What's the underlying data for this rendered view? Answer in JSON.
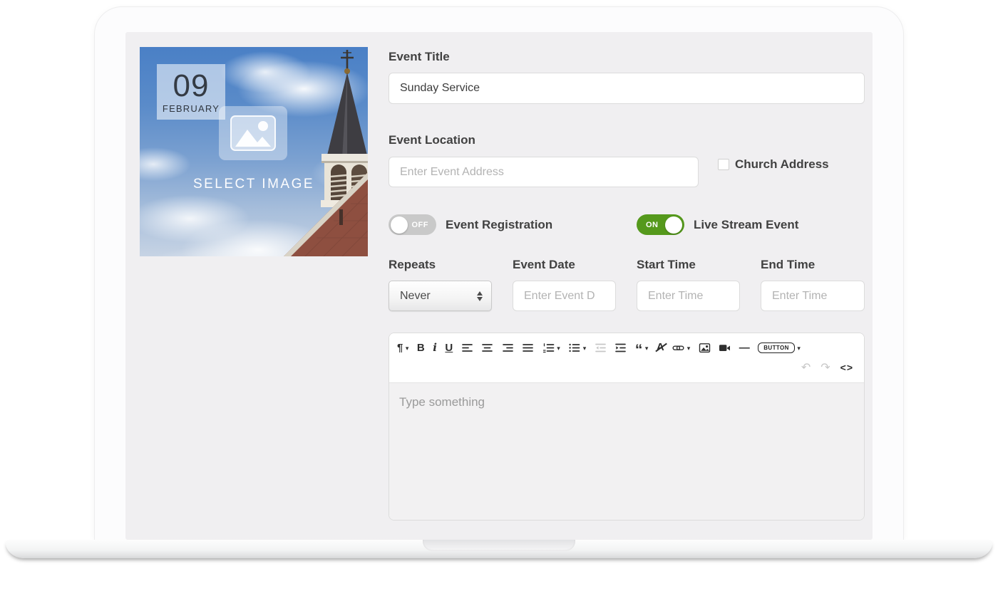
{
  "event_image": {
    "date_badge": {
      "day": "09",
      "month": "FEBRUARY"
    },
    "select_image_label": "SELECT IMAGE"
  },
  "form": {
    "event_title": {
      "label": "Event Title",
      "value": "Sunday Service"
    },
    "event_location": {
      "label": "Event Location",
      "placeholder": "Enter Event Address"
    },
    "church_address": {
      "label": "Church Address",
      "checked": false
    },
    "event_registration": {
      "label": "Event Registration",
      "state": "OFF"
    },
    "live_stream": {
      "label": "Live Stream Event",
      "state": "ON"
    },
    "repeats": {
      "label": "Repeats",
      "value": "Never"
    },
    "event_date": {
      "label": "Event Date",
      "placeholder": "Enter Event D"
    },
    "start_time": {
      "label": "Start Time",
      "placeholder": "Enter Time"
    },
    "end_time": {
      "label": "End Time",
      "placeholder": "Enter Time"
    }
  },
  "editor": {
    "placeholder": "Type something",
    "toolbar_row1": [
      {
        "name": "paragraph-format",
        "dropdown": true
      },
      {
        "name": "bold"
      },
      {
        "name": "italic"
      },
      {
        "name": "underline"
      },
      {
        "name": "align-left"
      },
      {
        "name": "align-center"
      },
      {
        "name": "align-right"
      },
      {
        "name": "align-justify"
      },
      {
        "name": "ordered-list",
        "dropdown": true
      },
      {
        "name": "unordered-list",
        "dropdown": true
      },
      {
        "name": "outdent",
        "disabled": true
      },
      {
        "name": "indent"
      },
      {
        "name": "quote",
        "dropdown": true
      },
      {
        "name": "clear-formatting"
      },
      {
        "name": "insert-link",
        "dropdown": true
      },
      {
        "name": "insert-image"
      },
      {
        "name": "insert-video"
      },
      {
        "name": "horizontal-line"
      },
      {
        "name": "insert-button",
        "label": "BUTTON",
        "dropdown": true
      }
    ],
    "toolbar_row2": [
      {
        "name": "undo",
        "disabled": true
      },
      {
        "name": "redo",
        "disabled": true
      },
      {
        "name": "code-view"
      }
    ]
  },
  "colors": {
    "toggle_on_green": "#55991c",
    "toggle_off_gray": "#c9c9c9",
    "sky_blue": "#4a80c6",
    "label_dark": "#414141"
  }
}
